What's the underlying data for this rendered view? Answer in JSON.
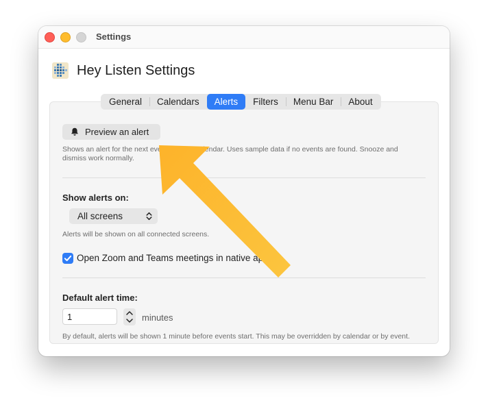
{
  "window": {
    "title": "Settings"
  },
  "header": {
    "title": "Hey Listen Settings",
    "icon": "app-grid-icon"
  },
  "tabs": [
    {
      "label": "General",
      "active": false
    },
    {
      "label": "Calendars",
      "active": false
    },
    {
      "label": "Alerts",
      "active": true
    },
    {
      "label": "Filters",
      "active": false
    },
    {
      "label": "Menu Bar",
      "active": false
    },
    {
      "label": "About",
      "active": false
    }
  ],
  "alerts": {
    "preview_button": {
      "label": "Preview an alert",
      "icon": "bell-icon"
    },
    "preview_note_line1": "Shows an alert for the next event on your calendar. Uses sample data if no events are found. Snooze and",
    "preview_note_line2": "dismiss work normally.",
    "show_on": {
      "label": "Show alerts on:",
      "selected": "All screens",
      "note": "Alerts will be shown on all connected screens."
    },
    "native_apps": {
      "label": "Open Zoom and Teams meetings in native apps",
      "checked": true
    },
    "default_time": {
      "label": "Default alert time:",
      "value": "1",
      "unit": "minutes",
      "note": "By default, alerts will be shown 1 minute before events start. This may be overridden by calendar or by event."
    }
  },
  "colors": {
    "accent": "#2f7cf6",
    "arrow": "#fbbd34",
    "close": "#ff5f57",
    "minimize": "#febc2e",
    "zoom": "#d5d5d5"
  }
}
